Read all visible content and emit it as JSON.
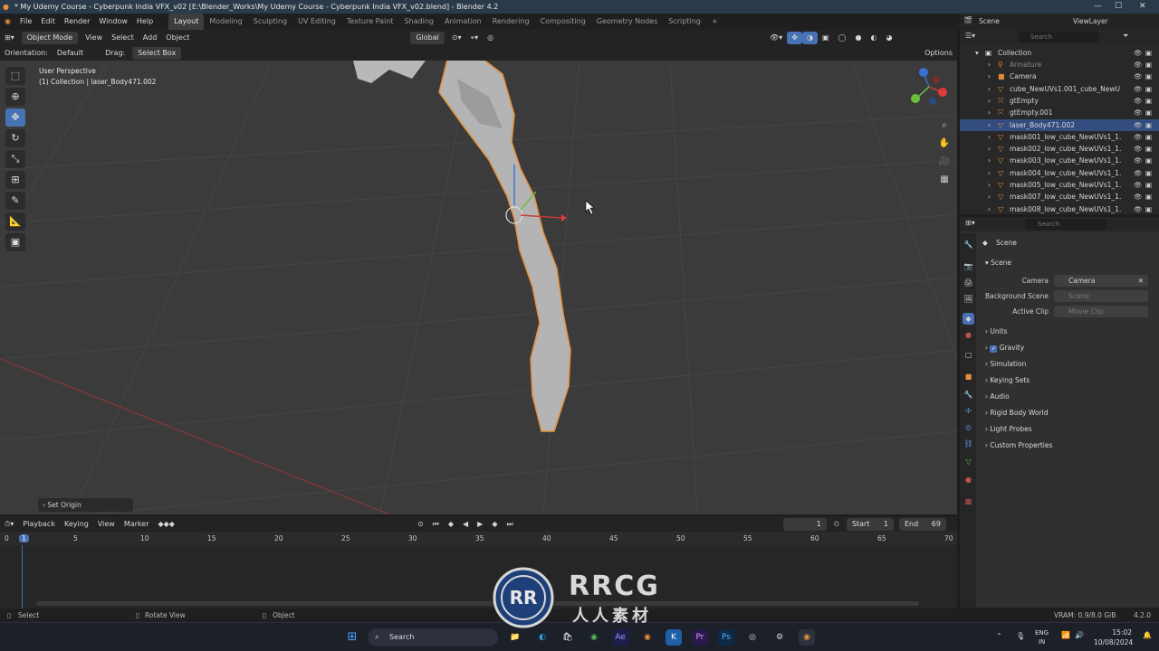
{
  "window": {
    "title": "* My Udemy Course - Cyberpunk India VFX_v02 [E:\\Blender_Works\\My Udemy Course - Cyberpunk India VFX_v02.blend] - Blender 4.2",
    "scene_name": "Scene",
    "view_layer": "ViewLayer"
  },
  "menu": {
    "items": [
      "File",
      "Edit",
      "Render",
      "Window",
      "Help"
    ],
    "workspaces": [
      "Layout",
      "Modeling",
      "Sculpting",
      "UV Editing",
      "Texture Paint",
      "Shading",
      "Animation",
      "Rendering",
      "Compositing",
      "Geometry Nodes",
      "Scripting"
    ],
    "active_workspace": "Layout",
    "add_tab": "+"
  },
  "viewport": {
    "mode": "Object Mode",
    "menus": [
      "View",
      "Select",
      "Add",
      "Object"
    ],
    "transform_orientation": "Global",
    "orientation_label": "Orientation:",
    "orientation_value": "Default",
    "drag_label": "Drag:",
    "drag_value": "Select Box",
    "options": "Options",
    "overlay_line1": "User Perspective",
    "overlay_line2": "(1) Collection | laser_Body471.002",
    "last_operator": "Set Origin"
  },
  "outliner": {
    "search_placeholder": "Search",
    "root": "Collection",
    "items": [
      {
        "label": "Armature",
        "icon": "armature-icon",
        "dim": true
      },
      {
        "label": "Camera",
        "icon": "camera-icon",
        "dim": false
      },
      {
        "label": "cube_NewUVs1.001_cube_NewU",
        "icon": "mesh-icon",
        "dim": false
      },
      {
        "label": "gtEmpty",
        "icon": "empty-icon",
        "dim": false
      },
      {
        "label": "gtEmpty.001",
        "icon": "empty-icon",
        "dim": false
      },
      {
        "label": "laser_Body471.002",
        "icon": "mesh-icon",
        "dim": false,
        "selected": true
      },
      {
        "label": "mask001_low_cube_NewUVs1_1.",
        "icon": "mesh-icon",
        "dim": false
      },
      {
        "label": "mask002_low_cube_NewUVs1_1.",
        "icon": "mesh-icon",
        "dim": false
      },
      {
        "label": "mask003_low_cube_NewUVs1_1.",
        "icon": "mesh-icon",
        "dim": false
      },
      {
        "label": "mask004_low_cube_NewUVs1_1.",
        "icon": "mesh-icon",
        "dim": false
      },
      {
        "label": "mask005_low_cube_NewUVs1_1.",
        "icon": "mesh-icon",
        "dim": false
      },
      {
        "label": "mask007_low_cube_NewUVs1_1.",
        "icon": "mesh-icon",
        "dim": false
      },
      {
        "label": "mask008_low_cube_NewUVs1_1.",
        "icon": "mesh-icon",
        "dim": false
      }
    ]
  },
  "properties": {
    "search_placeholder": "Search",
    "context": "Scene",
    "panel_title": "Scene",
    "camera_label": "Camera",
    "camera_value": "Camera",
    "background_scene_label": "Background Scene",
    "background_scene_placeholder": "Scene",
    "active_clip_label": "Active Clip",
    "active_clip_placeholder": "Movie Clip",
    "sections": [
      "Units",
      "Gravity",
      "Simulation",
      "Keying Sets",
      "Audio",
      "Rigid Body World",
      "Light Probes",
      "Custom Properties"
    ],
    "gravity_checked": true
  },
  "timeline": {
    "menus": [
      "Playback",
      "Keying",
      "View",
      "Marker"
    ],
    "current_frame": "1",
    "start_label": "Start",
    "start": "1",
    "end_label": "End",
    "end": "69",
    "ruler": [
      "0",
      "1",
      "5",
      "10",
      "15",
      "20",
      "25",
      "30",
      "35",
      "40",
      "45",
      "50",
      "55",
      "60",
      "65",
      "70"
    ]
  },
  "status": {
    "select": "Select",
    "rotate": "Rotate View",
    "object": "Object",
    "vram": "VRAM: 0.9/8.0 GiB",
    "version": "4.2.0"
  },
  "taskbar": {
    "search": "Search",
    "lang1": "ENG",
    "lang2": "IN",
    "time": "15:02",
    "date": "10/08/2024"
  },
  "watermark": {
    "line1": "RRCG",
    "line2": "人人素材"
  },
  "colors": {
    "accent": "#4772b3",
    "selection_outline": "#e8913a",
    "x_axis": "#c23b3b",
    "active_workspace": "#3d3d3d"
  }
}
